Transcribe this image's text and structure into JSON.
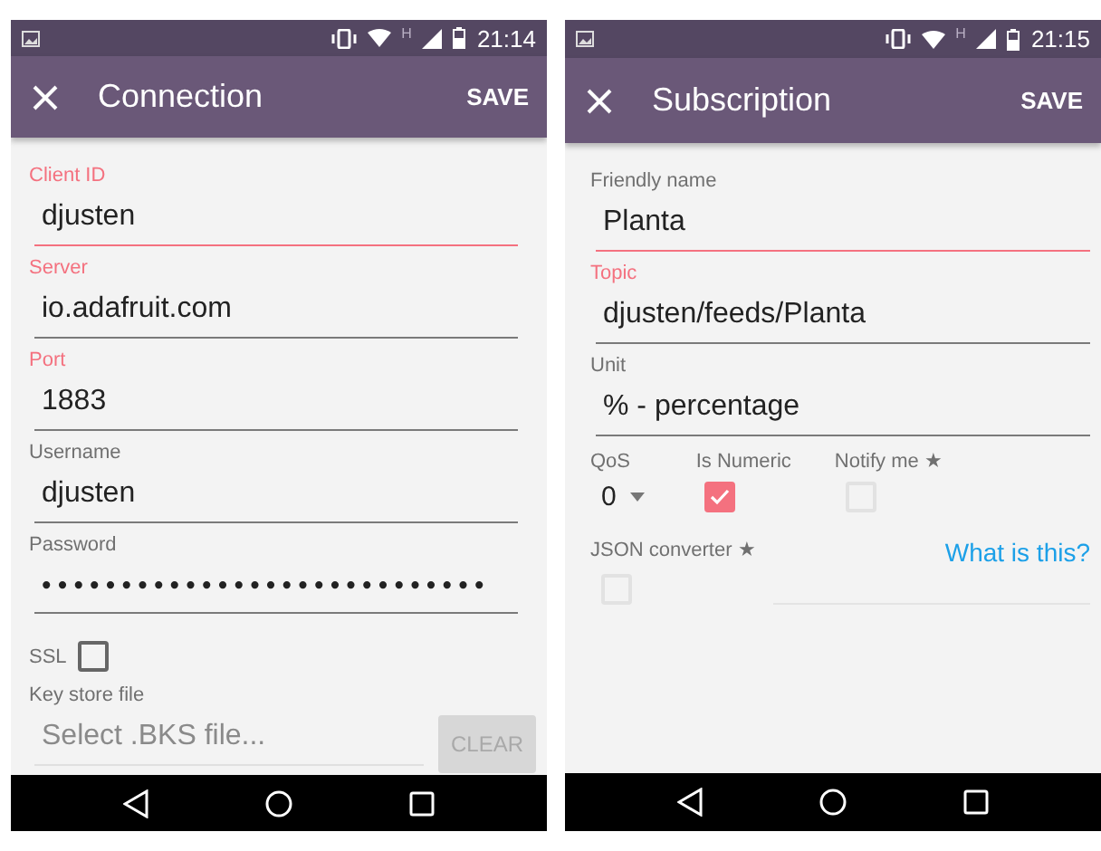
{
  "screens": [
    {
      "status": {
        "network": "H",
        "time": "21:14"
      },
      "appbar": {
        "title": "Connection",
        "action": "SAVE"
      },
      "items": [
        {
          "kind": "text",
          "label": "Client ID",
          "value": "djusten",
          "label_accent": true,
          "focused": true
        },
        {
          "kind": "text",
          "label": "Server",
          "value": "io.adafruit.com",
          "label_accent": true,
          "focused": false
        },
        {
          "kind": "text",
          "label": "Port",
          "value": "1883",
          "label_accent": true,
          "focused": false
        },
        {
          "kind": "text",
          "label": "Username",
          "value": "djusten",
          "label_accent": false,
          "focused": false
        },
        {
          "kind": "password",
          "label": "Password",
          "value": "••••••••••••••••••••••••••••",
          "label_accent": false,
          "focused": false
        },
        {
          "kind": "checkbox",
          "label": "SSL",
          "checked": false
        },
        {
          "kind": "file",
          "label": "Key store file",
          "placeholder": "Select .BKS file...",
          "button": {
            "label": "CLEAR",
            "disabled": true
          }
        }
      ]
    },
    {
      "status": {
        "network": "H",
        "time": "21:15"
      },
      "appbar": {
        "title": "Subscription",
        "action": "SAVE"
      },
      "items": [
        {
          "kind": "text",
          "label": "Friendly name",
          "value": "Planta",
          "label_accent": false,
          "focused": true
        },
        {
          "kind": "text",
          "label": "Topic",
          "value": "djusten/feeds/Planta",
          "label_accent": true,
          "focused": false
        },
        {
          "kind": "text",
          "label": "Unit",
          "value": "% - percentage",
          "label_accent": false,
          "focused": false
        },
        {
          "kind": "options",
          "qos": {
            "label": "QoS",
            "value": "0"
          },
          "checks": [
            {
              "label": "Is Numeric",
              "checked": true,
              "disabled": false
            },
            {
              "label": "Notify me ★",
              "checked": false,
              "disabled": true
            }
          ]
        },
        {
          "kind": "converter",
          "label": "JSON converter ★",
          "checked": false,
          "disabled": true,
          "link": "What is this?"
        }
      ]
    }
  ]
}
